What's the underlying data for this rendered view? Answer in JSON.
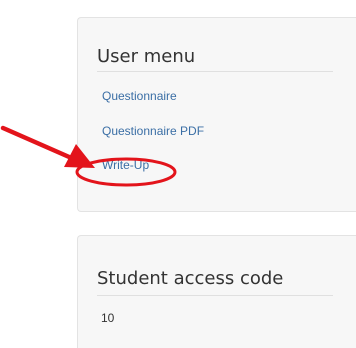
{
  "user_menu": {
    "title": "User menu",
    "items": [
      {
        "label": "Questionnaire"
      },
      {
        "label": "Questionnaire PDF"
      },
      {
        "label": "Write-Up"
      }
    ]
  },
  "access_code": {
    "title": "Student access code",
    "value": "10"
  },
  "annotation": {
    "color": "#e3141b"
  }
}
